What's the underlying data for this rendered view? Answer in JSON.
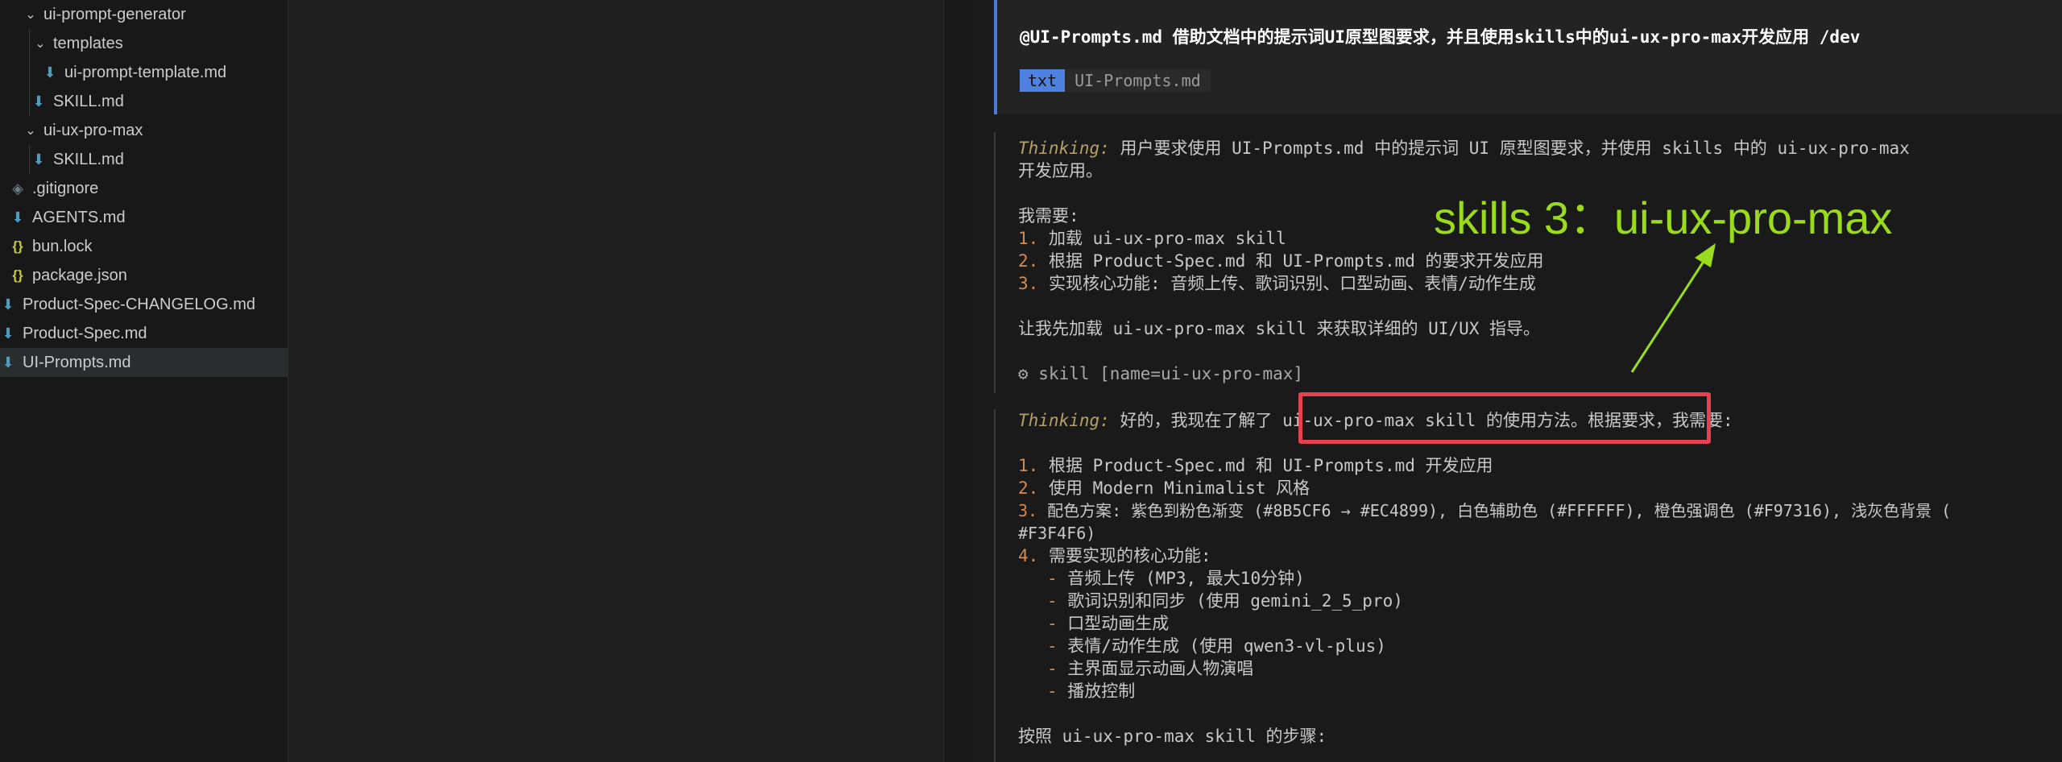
{
  "explorer": {
    "items": [
      {
        "label": "ui-prompt-generator",
        "kind": "folder",
        "expanded": true,
        "icon": "chevron-down-icon"
      },
      {
        "label": "templates",
        "kind": "folder",
        "expanded": true,
        "icon": "chevron-down-icon"
      },
      {
        "label": "ui-prompt-template.md",
        "kind": "file",
        "icon": "markdown-icon"
      },
      {
        "label": "SKILL.md",
        "kind": "file",
        "icon": "markdown-icon"
      },
      {
        "label": "ui-ux-pro-max",
        "kind": "folder",
        "expanded": true,
        "icon": "chevron-down-icon"
      },
      {
        "label": "SKILL.md",
        "kind": "file",
        "icon": "markdown-icon"
      },
      {
        "label": ".gitignore",
        "kind": "file",
        "icon": "git-icon"
      },
      {
        "label": "AGENTS.md",
        "kind": "file",
        "icon": "markdown-icon"
      },
      {
        "label": "bun.lock",
        "kind": "file",
        "icon": "json-icon"
      },
      {
        "label": "package.json",
        "kind": "file",
        "icon": "json-icon"
      },
      {
        "label": "Product-Spec-CHANGELOG.md",
        "kind": "file",
        "icon": "markdown-icon"
      },
      {
        "label": "Product-Spec.md",
        "kind": "file",
        "icon": "markdown-icon"
      },
      {
        "label": "UI-Prompts.md",
        "kind": "file",
        "icon": "markdown-icon",
        "selected": true
      }
    ]
  },
  "chat": {
    "user_message": "@UI-Prompts.md 借助文档中的提示词UI原型图要求，并且使用skills中的ui-ux-pro-max开发应用 /dev",
    "attachment": {
      "type": "txt",
      "name": "UI-Prompts.md"
    },
    "thinking_label": "Thinking:",
    "block1": {
      "thinking_text": " 用户要求使用 UI-Prompts.md 中的提示词 UI 原型图要求，并使用 skills 中的 ui-ux-pro-max",
      "thinking_text_cont": "开发应用。",
      "need_heading": "我需要:",
      "steps": [
        {
          "n": "1.",
          "text": " 加载 ui-ux-pro-max skill"
        },
        {
          "n": "2.",
          "text": " 根据 Product-Spec.md 和 UI-Prompts.md 的要求开发应用"
        },
        {
          "n": "3.",
          "text": " 实现核心功能: 音频上传、歌词识别、口型动画、表情/动作生成"
        }
      ],
      "followup": "让我先加载 ui-ux-pro-max skill 来获取详细的 UI/UX 指导。",
      "tool_call": "skill [name=ui-ux-pro-max]"
    },
    "block2": {
      "thinking_pre": " 好的，我现在了解了 ",
      "thinking_highlight": "ui-ux-pro-max skill 的使用方法。根据要求，",
      "thinking_post": "我需要:",
      "steps": [
        {
          "n": "1.",
          "text": " 根据 Product-Spec.md 和 UI-Prompts.md 开发应用"
        },
        {
          "n": "2.",
          "text": " 使用 Modern Minimalist 风格"
        },
        {
          "n": "3.",
          "text": " 配色方案: 紫色到粉色渐变 (#8B5CF6 → #EC4899), 白色辅助色 (#FFFFFF), 橙色强调色 (#F97316), 浅灰色背景 ("
        },
        {
          "n": "",
          "text": "#F3F4F6)"
        },
        {
          "n": "4.",
          "text": " 需要实现的核心功能:"
        }
      ],
      "features": [
        "音频上传 (MP3, 最大10分钟)",
        "歌词识别和同步 (使用 gemini_2_5_pro)",
        "口型动画生成",
        "表情/动作生成 (使用 qwen3-vl-plus)",
        "主界面显示动画人物演唱",
        "播放控制"
      ],
      "followup": "按照 ui-ux-pro-max skill 的步骤:"
    }
  },
  "annotation": {
    "text": "skills 3：ui-ux-pro-max",
    "color": "#9bdb1e",
    "box_color": "#e5414f"
  }
}
